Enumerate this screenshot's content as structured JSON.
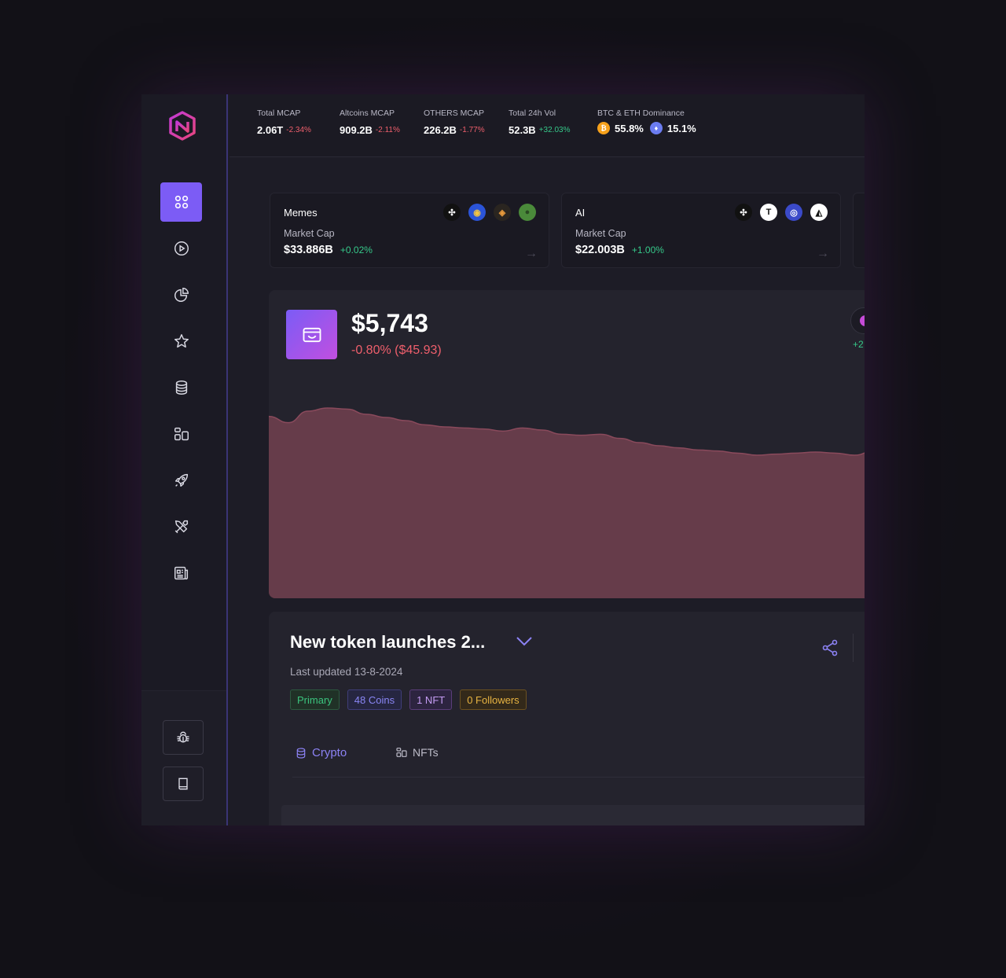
{
  "stats": [
    {
      "label": "Total MCAP",
      "value": "2.06T",
      "change": "-2.34%",
      "trend": "neg"
    },
    {
      "label": "Altcoins MCAP",
      "value": "909.2B",
      "change": "-2.11%",
      "trend": "neg"
    },
    {
      "label": "OTHERS MCAP",
      "value": "226.2B",
      "change": "-1.77%",
      "trend": "neg"
    },
    {
      "label": "Total 24h Vol",
      "value": "52.3B",
      "change": "+32.03%",
      "trend": "pos"
    }
  ],
  "dominance": {
    "label": "BTC & ETH Dominance",
    "btc_value": "55.8%",
    "eth_value": "15.1%",
    "btc_icon": "₿",
    "eth_icon": "♦"
  },
  "categories": [
    {
      "name": "Memes",
      "sub_label": "Market Cap",
      "value": "$33.886B",
      "change": "+0.02%",
      "icons": [
        "✣",
        "◉",
        "◈",
        "●"
      ]
    },
    {
      "name": "AI",
      "sub_label": "Market Cap",
      "value": "$22.003B",
      "change": "+1.00%",
      "icons": [
        "✣",
        "T",
        "◎",
        "◭"
      ]
    }
  ],
  "portfolio": {
    "value": "$5,743",
    "change": "-0.80% ($45.93)",
    "peek_change": "+2"
  },
  "watchlist": {
    "title": "New token launches 2...",
    "last_updated": "Last updated 13-8-2024",
    "tags": [
      "Primary",
      "48 Coins",
      "1 NFT",
      "0 Followers"
    ],
    "tabs": [
      "Crypto",
      "NFTs"
    ]
  },
  "colors": {
    "accent": "#7c5cf5",
    "negative": "#ef5f6c",
    "positive": "#36c98a",
    "chart_fill": "#663c4a",
    "chart_line": "#8a4a5c"
  },
  "nav_icons": [
    "dashboard-icon",
    "play-icon",
    "pie-chart-icon",
    "star-icon",
    "database-icon",
    "nft-icon",
    "rocket-icon",
    "tools-icon",
    "news-icon"
  ],
  "bottom_icons": [
    "bug-icon",
    "book-icon"
  ],
  "chart_data": {
    "type": "area",
    "series": [
      {
        "values": [
          100,
          99.4,
          100.5,
          100.8,
          100.7,
          100.2,
          99.9,
          99.6,
          99.2,
          99.0,
          98.9,
          98.8,
          98.6,
          98.9,
          98.7,
          98.3,
          98.2,
          98.3,
          97.9,
          97.5,
          97.2,
          97.0,
          96.8,
          96.7,
          96.5,
          96.3,
          96.4,
          96.5,
          96.6,
          96.5,
          96.3,
          96.7
        ]
      }
    ],
    "grid": false
  }
}
